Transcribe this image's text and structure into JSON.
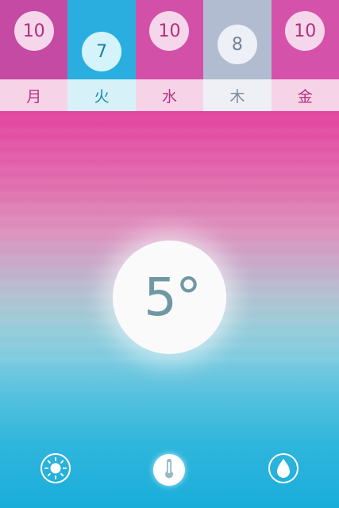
{
  "days": [
    {
      "label": "月",
      "value": "10",
      "col_color": "#c44aa3",
      "strip_color": "#f7d3e7",
      "label_color": "#b0357f",
      "bubble_color": "#f5d6ea",
      "value_color": "#b0307c"
    },
    {
      "label": "火",
      "value": "7",
      "col_color": "#2aaee0",
      "strip_color": "#d7f1f8",
      "label_color": "#1889ad",
      "bubble_color": "#d5f3fb",
      "value_color": "#1a7f9e"
    },
    {
      "label": "水",
      "value": "10",
      "col_color": "#d350a9",
      "strip_color": "#f7d3e7",
      "label_color": "#b0357f",
      "bubble_color": "#f5d6ea",
      "value_color": "#b0307c"
    },
    {
      "label": "木",
      "value": "8",
      "col_color": "#b2bcd1",
      "strip_color": "#eef0f6",
      "label_color": "#7f8c9c",
      "bubble_color": "#edf0f6",
      "value_color": "#748496"
    },
    {
      "label": "金",
      "value": "10",
      "col_color": "#d552aa",
      "strip_color": "#f7d3e7",
      "label_color": "#b0357f",
      "bubble_color": "#f5d6ea",
      "value_color": "#b0307c"
    }
  ],
  "current": {
    "temperature": "5°"
  },
  "toolbar": {
    "items": [
      {
        "icon": "sun-icon",
        "name": "weather-button"
      },
      {
        "icon": "thermometer-icon",
        "name": "temperature-button"
      },
      {
        "icon": "drop-icon",
        "name": "precipitation-button"
      }
    ]
  }
}
